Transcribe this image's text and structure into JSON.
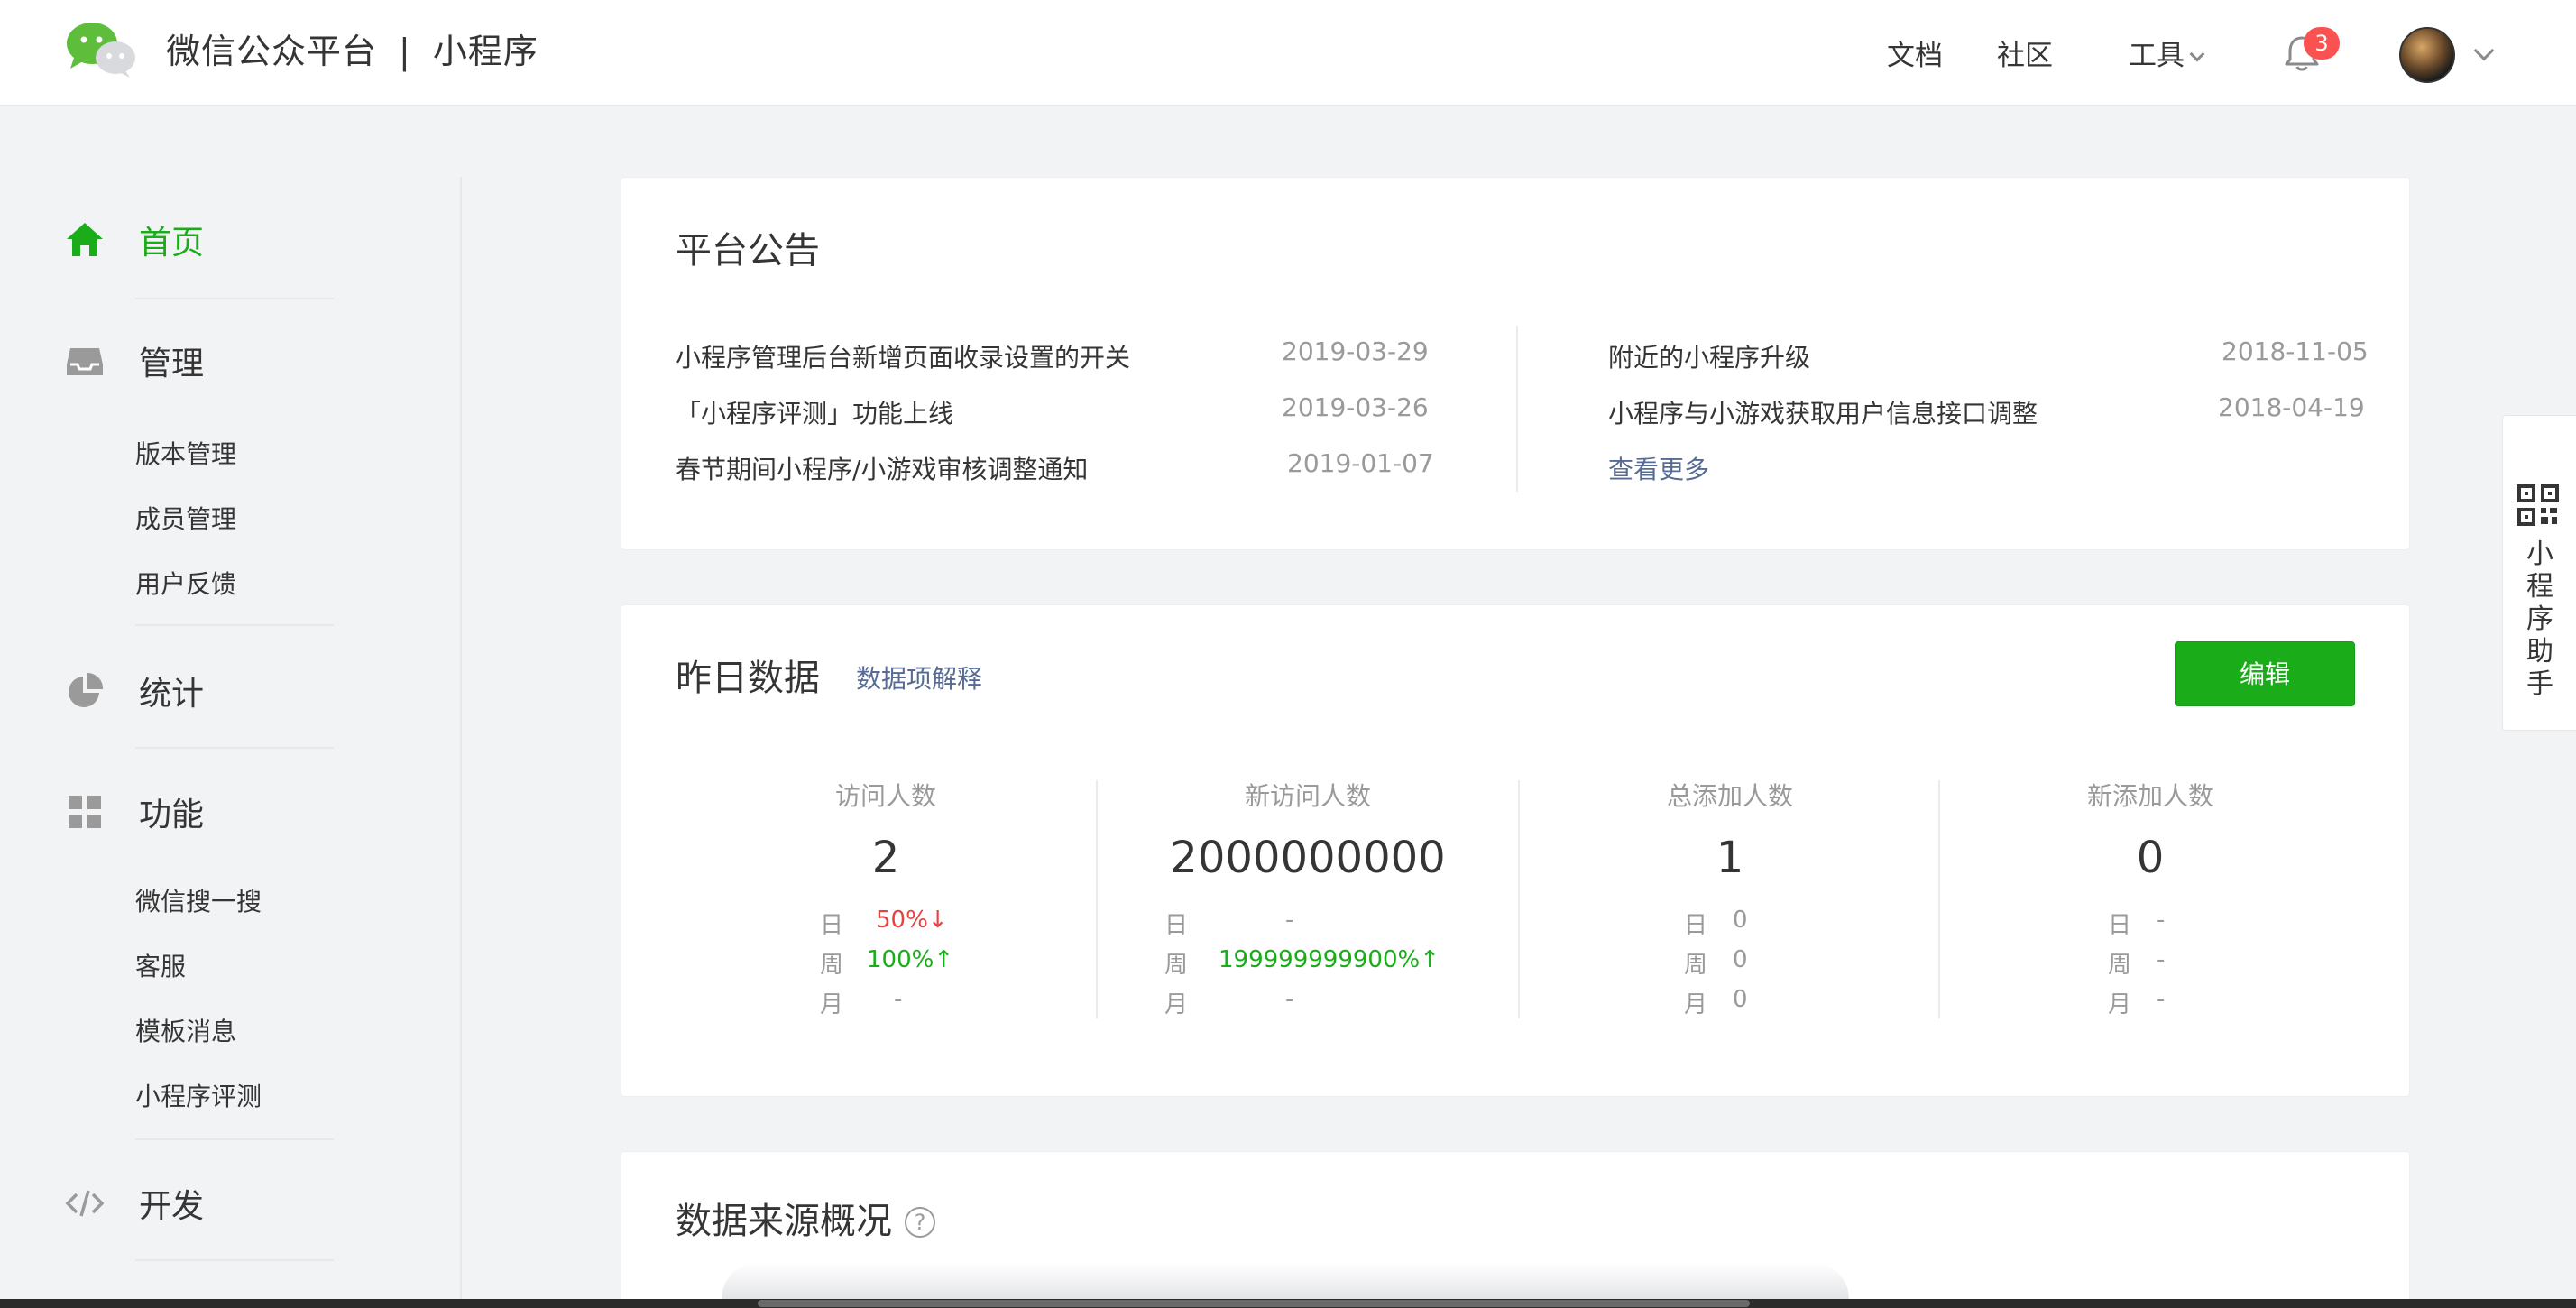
{
  "header": {
    "brand_name": "微信公众平台",
    "brand_separator": "|",
    "product_name": "小程序",
    "nav": {
      "docs": "文档",
      "community": "社区",
      "tools": "工具"
    },
    "notification_count": "3"
  },
  "sidebar": {
    "home": "首页",
    "manage": {
      "label": "管理",
      "items": [
        "版本管理",
        "成员管理",
        "用户反馈"
      ]
    },
    "stats": "统计",
    "features": {
      "label": "功能",
      "items": [
        "微信搜一搜",
        "客服",
        "模板消息",
        "小程序评测"
      ]
    },
    "develop": "开发"
  },
  "announcements": {
    "title": "平台公告",
    "left": [
      {
        "title": "小程序管理后台新增页面收录设置的开关",
        "date": "2019-03-29"
      },
      {
        "title": "「小程序评测」功能上线",
        "date": "2019-03-26"
      },
      {
        "title": "春节期间小程序/小游戏审核调整通知",
        "date": "2019-01-07"
      }
    ],
    "right": [
      {
        "title": "附近的小程序升级",
        "date": "2018-11-05"
      },
      {
        "title": "小程序与小游戏获取用户信息接口调整",
        "date": "2018-04-19"
      }
    ],
    "more": "查看更多"
  },
  "yesterday": {
    "title": "昨日数据",
    "explain_link": "数据项解释",
    "edit_button": "编辑",
    "row_labels": {
      "day": "日",
      "week": "周",
      "month": "月"
    },
    "metrics": [
      {
        "label": "访问人数",
        "value": "2",
        "day": "50%↓",
        "week": "100%↑",
        "month": "-"
      },
      {
        "label": "新访问人数",
        "value": "2000000000",
        "day": "-",
        "week": "199999999900%↑",
        "month": "-"
      },
      {
        "label": "总添加人数",
        "value": "1",
        "day": "0",
        "week": "0",
        "month": "0"
      },
      {
        "label": "新添加人数",
        "value": "0",
        "day": "-",
        "week": "-",
        "month": "-"
      }
    ]
  },
  "sources": {
    "title": "数据来源概况",
    "help": "?"
  },
  "helper": {
    "text": "小程序助手"
  },
  "colors": {
    "brand_green": "#1aad19",
    "link_blue": "#576b95",
    "down_red": "#e64340",
    "badge_red": "#fa5151"
  }
}
